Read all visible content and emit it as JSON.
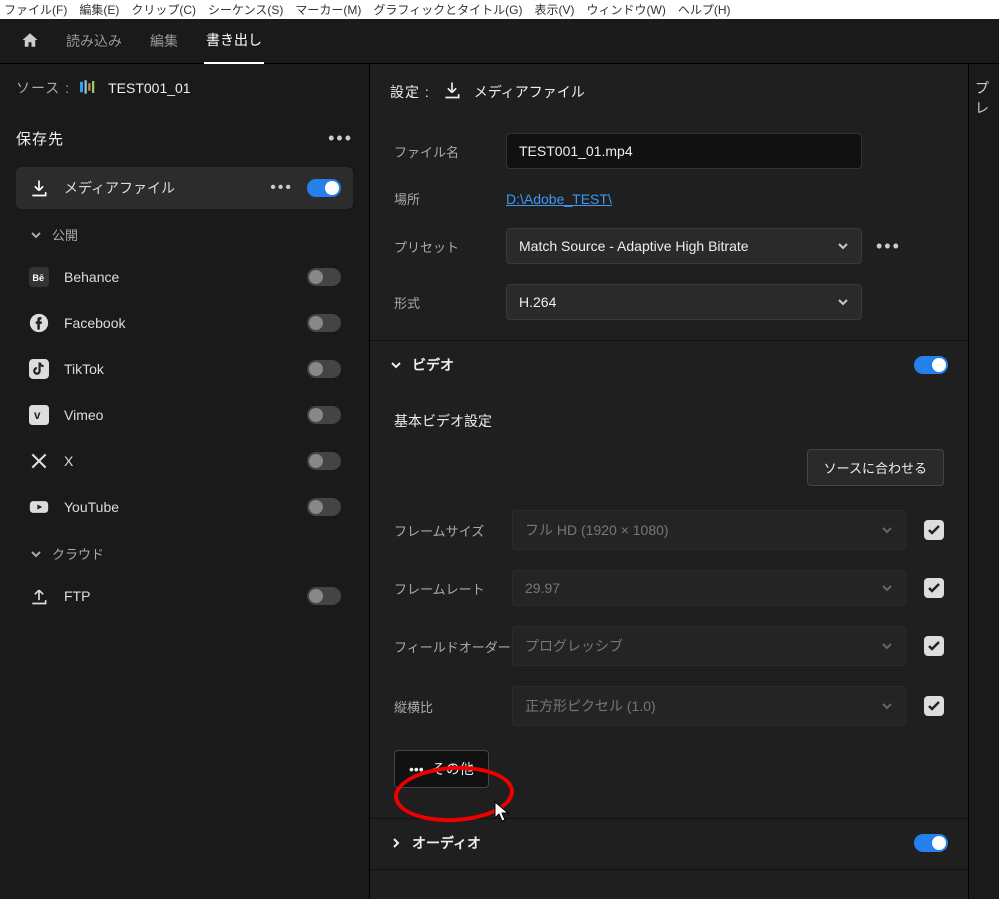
{
  "menubar": [
    "ファイル(F)",
    "編集(E)",
    "クリップ(C)",
    "シーケンス(S)",
    "マーカー(M)",
    "グラフィックとタイトル(G)",
    "表示(V)",
    "ウィンドウ(W)",
    "ヘルプ(H)"
  ],
  "topnav": {
    "import": "読み込み",
    "edit": "編集",
    "export": "書き出し"
  },
  "source": {
    "label": "ソース :",
    "name": "TEST001_01"
  },
  "dest": {
    "header": "保存先",
    "media_file": "メディアファイル",
    "publish_header": "公開",
    "items": [
      {
        "name": "Behance"
      },
      {
        "name": "Facebook"
      },
      {
        "name": "TikTok"
      },
      {
        "name": "Vimeo"
      },
      {
        "name": "X"
      },
      {
        "name": "YouTube"
      }
    ],
    "cloud_header": "クラウド",
    "ftp": "FTP"
  },
  "settings": {
    "header": "設定 :",
    "media_file": "メディアファイル",
    "filename_label": "ファイル名",
    "filename_value": "TEST001_01.mp4",
    "location_label": "場所",
    "location_value": "D:\\Adobe_TEST\\",
    "preset_label": "プリセット",
    "preset_value": "Match Source - Adaptive High Bitrate",
    "format_label": "形式",
    "format_value": "H.264"
  },
  "video": {
    "section": "ビデオ",
    "heading": "基本ビデオ設定",
    "match_source": "ソースに合わせる",
    "frame_size_label": "フレームサイズ",
    "frame_size_value": "フル HD (1920 × 1080)",
    "frame_rate_label": "フレームレート",
    "frame_rate_value": "29.97",
    "field_order_label": "フィールドオーダー",
    "field_order_value": "プログレッシブ",
    "aspect_label": "縦横比",
    "aspect_value": "正方形ピクセル (1.0)",
    "other": "その他"
  },
  "audio": {
    "section": "オーディオ"
  },
  "right_label": "プレ"
}
